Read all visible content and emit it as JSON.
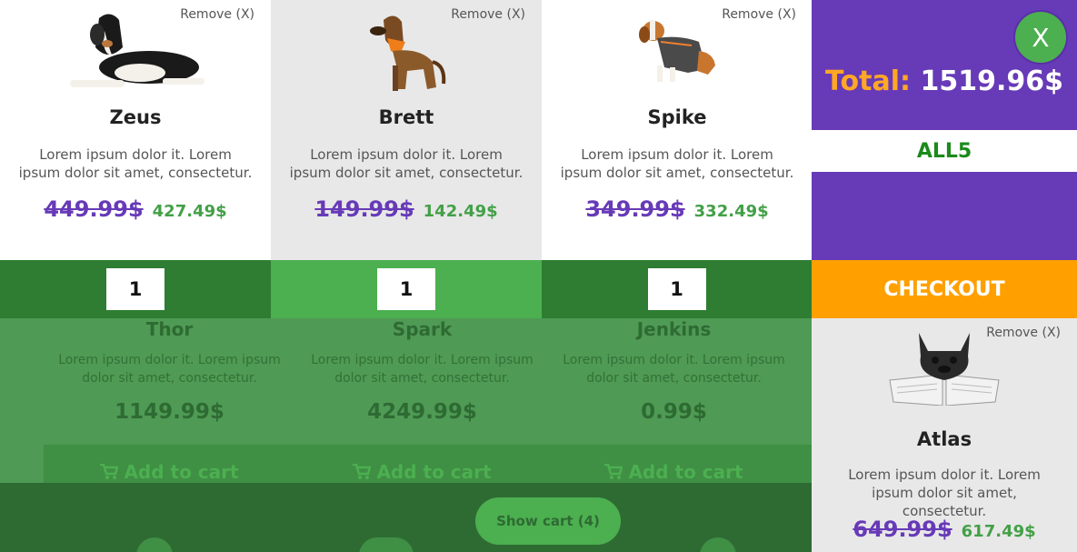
{
  "shop": {
    "products": [
      {
        "name": "Thor",
        "desc": "Lorem ipsum dolor it. Lorem ipsum dolor sit amet, consectetur.",
        "price": "1149.99$"
      },
      {
        "name": "Spark",
        "desc": "Lorem ipsum dolor it. Lorem ipsum dolor sit amet, consectetur.",
        "price": "4249.99$"
      },
      {
        "name": "Jenkins",
        "desc": "Lorem ipsum dolor it. Lorem ipsum dolor sit amet, consectetur.",
        "price": "0.99$"
      }
    ],
    "add_to_cart_label": "Add to cart",
    "cart_icon": "cart-icon",
    "show_cart_label": "Show cart (4)"
  },
  "cart": {
    "remove_label": "Remove (X)",
    "items": [
      {
        "name": "Zeus",
        "desc": "Lorem ipsum dolor it. Lorem ipsum dolor sit amet, consectetur.",
        "old_price": "449.99$",
        "new_price": "427.49$",
        "quantity": "1",
        "image": "dog-zeus-image"
      },
      {
        "name": "Brett",
        "desc": "Lorem ipsum dolor it. Lorem ipsum dolor sit amet, consectetur.",
        "old_price": "149.99$",
        "new_price": "142.49$",
        "quantity": "1",
        "image": "dog-brett-image"
      },
      {
        "name": "Spike",
        "desc": "Lorem ipsum dolor it. Lorem ipsum dolor sit amet, consectetur.",
        "old_price": "349.99$",
        "new_price": "332.49$",
        "quantity": "1",
        "image": "dog-spike-image"
      },
      {
        "name": "Atlas",
        "desc": "Lorem ipsum dolor it. Lorem ipsum dolor sit amet, consectetur.",
        "old_price": "649.99$",
        "new_price": "617.49$",
        "image": "dog-atlas-image"
      }
    ],
    "total_label": "Total:",
    "total_value": "1519.96$",
    "coupon_code": "ALL5",
    "checkout_label": "CHECKOUT",
    "close_label": "X"
  },
  "colors": {
    "purple": "#673ab7",
    "orange": "#ffa000",
    "green": "#4caf50",
    "dark_green": "#2e7d32"
  }
}
